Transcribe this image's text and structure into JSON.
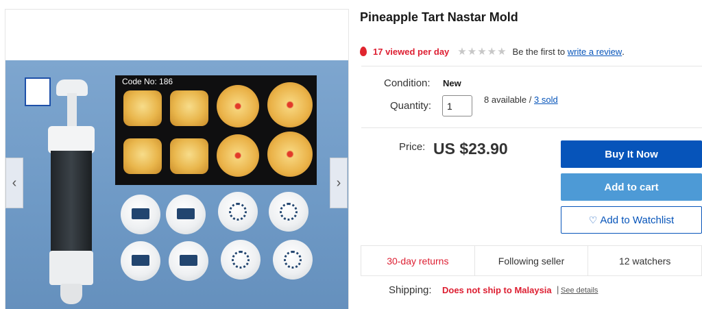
{
  "product": {
    "title": "Pineapple Tart Nastar Mold",
    "image_code": "Code No: 186"
  },
  "gallery": {
    "prev_icon": "chevron-left-icon",
    "next_icon": "chevron-right-icon",
    "prev_glyph": "‹",
    "next_glyph": "›"
  },
  "rating": {
    "viewed": "17 viewed per day",
    "stars_filled": 0,
    "stars_total": 5,
    "review_prefix": "Be the first to",
    "review_link": "write a review",
    "review_suffix": "."
  },
  "details": {
    "condition_label": "Condition:",
    "condition_value": "New",
    "quantity_label": "Quantity:",
    "quantity_value": "1",
    "available_text": "8 available /",
    "sold_link": "3 sold"
  },
  "price": {
    "label": "Price:",
    "value": "US $23.90"
  },
  "actions": {
    "buy_now": "Buy It Now",
    "add_to_cart": "Add to cart",
    "watchlist": "Add to Watchlist",
    "heart_glyph": "♡"
  },
  "stats": {
    "returns": "30-day returns",
    "following": "Following seller",
    "watchers": "12 watchers"
  },
  "shipping": {
    "label": "Shipping:",
    "value": "Does not ship to Malaysia",
    "separator": "|",
    "details_link": "See details"
  },
  "colors": {
    "primary_blue": "#0654ba",
    "secondary_blue": "#4d9ad6",
    "alert_red": "#dd1e31"
  }
}
